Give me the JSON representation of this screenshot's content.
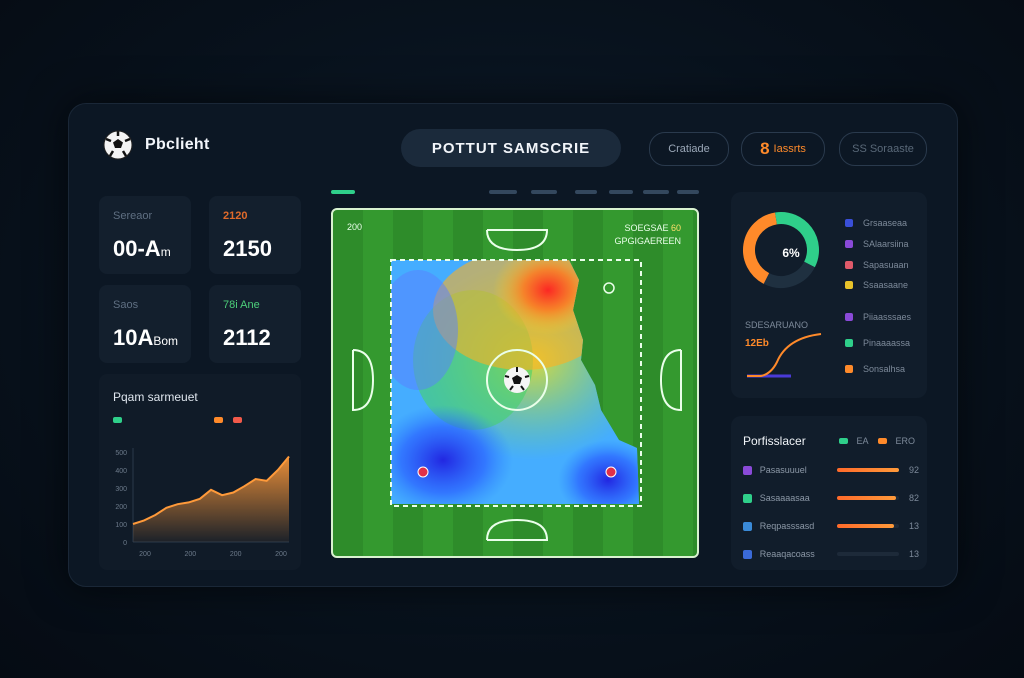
{
  "header": {
    "brand": "Pbclieht",
    "title": "POTTUT SAMSCRIE",
    "buttons": [
      {
        "label": "Cratiade"
      },
      {
        "prefix": "8",
        "label": "Iassrts"
      },
      {
        "label": "SS Soraaste"
      }
    ]
  },
  "stats": [
    {
      "label": "Sereaor",
      "value": "00-A",
      "unit": "m"
    },
    {
      "label": "2120",
      "value": "2150"
    },
    {
      "label": "Saos",
      "value": "10A",
      "unit": "Bom"
    },
    {
      "label": "78i Ane",
      "value": "2112"
    }
  ],
  "area_chart": {
    "title": "Pqam sarmeuet",
    "legend": [
      {
        "label": "",
        "color": "#2fcf8a"
      },
      {
        "label": "",
        "color": "#ff8a2a"
      },
      {
        "label": "",
        "color": "#f25a4a"
      }
    ]
  },
  "chart_data": {
    "type": "area",
    "title": "Pqam sarmeuet",
    "x": [
      0,
      1,
      2,
      3,
      4,
      5,
      6,
      7,
      8,
      9,
      10,
      11,
      12,
      13,
      14
    ],
    "series": [
      {
        "values": [
          20,
          24,
          30,
          38,
          42,
          44,
          48,
          58,
          52,
          55,
          62,
          70,
          68,
          80,
          95
        ],
        "color": "#ff9a3a"
      }
    ],
    "yticks": [
      "0",
      "100",
      "200",
      "300",
      "400",
      "500"
    ],
    "xticks": [
      "200",
      "200",
      "200",
      "200"
    ],
    "ylim": [
      0,
      100
    ]
  },
  "pitch": {
    "corner_label": "200",
    "score_line1": "SOEGSAE",
    "score_suffix": "60",
    "score_line2": "GPGIGAEREEN"
  },
  "donut": {
    "center": "6%",
    "segments": [
      {
        "value": 40,
        "color": "#ff8a2a"
      },
      {
        "value": 35,
        "color": "#2fcf8a"
      },
      {
        "value": 25,
        "color": "#1f3040"
      }
    ],
    "legend": [
      {
        "label": "Grsaaseaa",
        "color": "#3a4fd8"
      },
      {
        "label": "SAlaarsiina",
        "color": "#8a4ad8"
      },
      {
        "label": "Sapasuaan",
        "color": "#e05a6a"
      },
      {
        "label": "Ssaasaane",
        "color": "#e8c22a"
      },
      {
        "label": "Piiaasssaes",
        "color": "#8a4ad8"
      },
      {
        "label": "Pinaaaassa",
        "color": "#2fcf8a"
      },
      {
        "label": "Sonsalhsa",
        "color": "#ff8a2a"
      }
    ],
    "spark_label": "SDESARUANO",
    "spark_value": "12Eb"
  },
  "bars": {
    "title": "Porfisslacer",
    "legend_text1": "EA",
    "legend_text2": "ERO",
    "rows": [
      {
        "name": "Pasasuuuel",
        "value": 100,
        "pct": "92",
        "color": "#8a4ad8"
      },
      {
        "name": "Sasaaaasaa",
        "value": 95,
        "pct": "82",
        "color": "#2fcf8a"
      },
      {
        "name": "Reqpasssasd",
        "value": 92,
        "pct": "13",
        "color": "#3a8ad8"
      },
      {
        "name": "Reaaqacoass",
        "value": 0,
        "pct": "13",
        "color": "#3a6ad8"
      }
    ]
  }
}
